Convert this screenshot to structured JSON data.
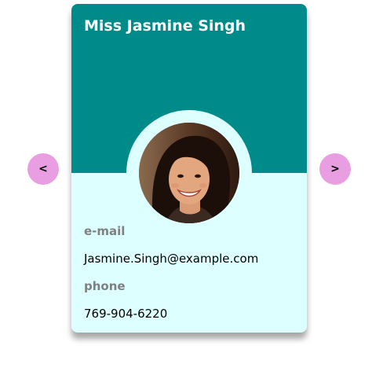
{
  "profile": {
    "name": "Miss Jasmine Singh",
    "email_label": "e-mail",
    "email": "Jasmine.Singh@example.com",
    "phone_label": "phone",
    "phone": "769-904-6220"
  },
  "nav": {
    "prev_label": "<",
    "next_label": ">"
  },
  "colors": {
    "header": "#008b8b",
    "card_body": "#ddffff",
    "nav_button": "#e89ee0",
    "label_text": "#808080"
  }
}
